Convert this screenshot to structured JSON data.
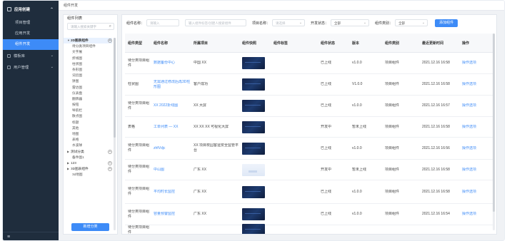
{
  "nav": {
    "top": "应用创建",
    "sub_items": [
      "项目管理",
      "应用开发",
      "组件开发"
    ],
    "active_index": 2,
    "groups": [
      "模板库",
      "用户管理"
    ],
    "bottom_icon": "menu-icon"
  },
  "breadcrumb": "组件开发",
  "tree": {
    "title": "组件列表",
    "search_placeholder": "请输入搜索关键字",
    "nodes": [
      {
        "label": "2D图表组件",
        "type": "root",
        "plus": true
      },
      {
        "label": "待分类项目组件",
        "type": "child"
      },
      {
        "label": "文字展",
        "type": "child"
      },
      {
        "label": "折线图",
        "type": "child"
      },
      {
        "label": "柱状图",
        "type": "child"
      },
      {
        "label": "条形图",
        "type": "child"
      },
      {
        "label": "词云图",
        "type": "child"
      },
      {
        "label": "饼图",
        "type": "child"
      },
      {
        "label": "雷达图",
        "type": "child"
      },
      {
        "label": "仪表盘",
        "type": "child"
      },
      {
        "label": "翻牌器",
        "type": "child"
      },
      {
        "label": "按钮",
        "type": "child"
      },
      {
        "label": "导航栏",
        "type": "child"
      },
      {
        "label": "散点图",
        "type": "child"
      },
      {
        "label": "标题",
        "type": "child"
      },
      {
        "label": "其他",
        "type": "child"
      },
      {
        "label": "地图",
        "type": "child"
      },
      {
        "label": "表格",
        "type": "child"
      },
      {
        "label": "水波球",
        "type": "child"
      },
      {
        "label": "测试分类",
        "type": "group",
        "plus": true
      },
      {
        "label": "备件图1",
        "type": "child"
      },
      {
        "label": "123",
        "type": "group",
        "plus": true
      },
      {
        "label": "3D图表组件",
        "type": "group",
        "plus": true
      },
      {
        "label": "3d地图",
        "type": "child"
      }
    ],
    "add_button": "新增分类"
  },
  "filters": {
    "name_label": "组件名称：",
    "name_placeholder": "请输入",
    "area_placeholder": "输入组件标签/创建人搜索组件",
    "project_label": "项目名称：",
    "project_placeholder": "请选择",
    "dev_status_label": "开发状态：",
    "dev_status_value": "全部",
    "group_label": "组件类别：",
    "group_value": "全部",
    "add_button": "添加组件"
  },
  "table": {
    "headers": [
      "组件类型",
      "组件名称",
      "所属项目",
      "组件快照",
      "组件标签",
      "组件状态",
      "版本",
      "组件类别",
      "最近更新时间",
      "操作"
    ],
    "rows": [
      {
        "type": "待分类项目组件",
        "name": "数据备份中心",
        "project": "中国 XX",
        "thumb": "dark",
        "tag": "",
        "status": "已上线",
        "version": "v1.0.0",
        "category": "项目组件",
        "time": "2021.12.16 16:58",
        "op": "操作选项"
      },
      {
        "type": "柱状图",
        "name": "无需通过修改后再3D柱形图",
        "project": "客户成功",
        "thumb": "dark",
        "tag": "",
        "status": "已上线",
        "version": "V1.0.0",
        "category": "项目组件",
        "time": "2021.12.16 16:58",
        "op": "操作选项"
      },
      {
        "type": "待分类项目组件",
        "name": "XX  2022折线图",
        "project": "XX 大屏",
        "thumb": "dark",
        "tag": "",
        "status": "已上线",
        "version": "v1.0.0",
        "category": "项目组件",
        "time": "2021.12.16 16:57",
        "op": "操作选项"
      },
      {
        "type": "表格",
        "name": "工单列表 — XX",
        "project": "XX XX XX  可视化大屏",
        "thumb": "dark",
        "tag": "",
        "status": "开发中",
        "version": "暂未上线",
        "category": "项目组件",
        "time": "2021.12.16 16:58",
        "op": "操作选项"
      },
      {
        "type": "待分类项目组件",
        "name": "zhfVdjc",
        "project": "XX  项目校园客运安全监管平台",
        "thumb": "dark",
        "tag": "",
        "status": "已上线",
        "version": "v1.0.0",
        "category": "项目组件",
        "time": "2021.12.16 16:56",
        "op": "操作选项"
      },
      {
        "type": "待分类项目组件",
        "name": "中山图",
        "project": "广东 XX",
        "thumb": "light",
        "tag": "",
        "status": "开发中",
        "version": "暂未上线",
        "category": "项目组件",
        "time": "2021.12.16 16:58",
        "op": "操作选项"
      },
      {
        "type": "待分类项目组件",
        "name": "平均时长监控",
        "project": "广东 XX",
        "thumb": "dark",
        "tag": "",
        "status": "已上线",
        "version": "v1.0.0",
        "category": "项目组件",
        "time": "2021.12.16 16:58",
        "op": "操作选项"
      },
      {
        "type": "待分类项目组件",
        "name": "容量预警监控",
        "project": "广东 XX",
        "thumb": "dark",
        "tag": "",
        "status": "已上线",
        "version": "v1.0.0",
        "category": "项目组件",
        "time": "2021.12.16 16:54",
        "op": "操作选项"
      },
      {
        "type": "待分类项目组件",
        "name": "",
        "project": "",
        "thumb": "dark",
        "tag": "",
        "status": "",
        "version": "",
        "category": "",
        "time": "",
        "op": ""
      }
    ]
  },
  "colors": {
    "accent": "#3d8bf7",
    "nav_bg": "#1f2d3d"
  }
}
